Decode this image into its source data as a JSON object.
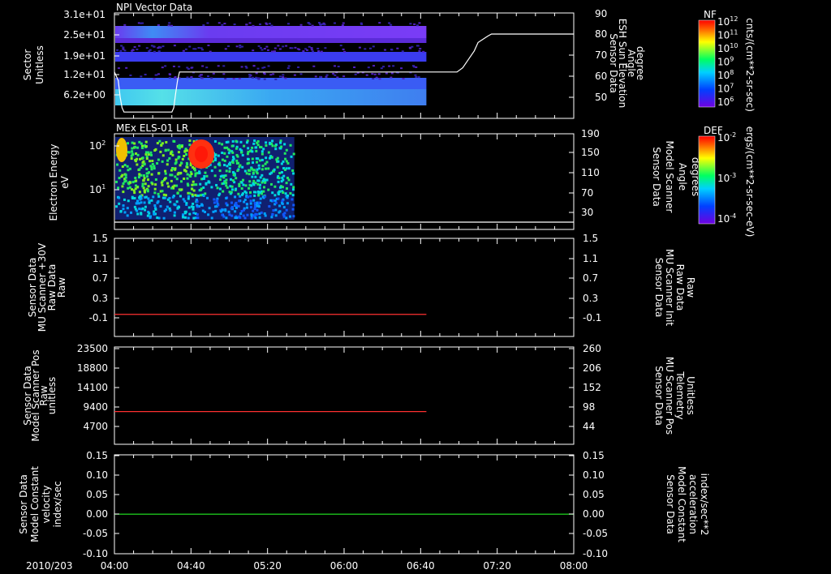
{
  "chart_data": [
    {
      "type": "heatmap",
      "title": "NPI Vector Data",
      "ylabel": [
        "Sector",
        "Unitless"
      ],
      "yticks": [
        "3.1e+01",
        "2.5e+01",
        "1.9e+01",
        "1.2e+01",
        "6.2e+00"
      ],
      "y2label": [
        "Sensor Data",
        "ESH Sun Elevation",
        "Angle",
        "degree"
      ],
      "y2ticks": [
        90,
        80,
        70,
        60,
        50
      ],
      "y2lim": [
        40,
        90
      ],
      "overlay_line": {
        "name": "ESH Sun Elevation Angle",
        "x": [
          "04:00",
          "04:02",
          "04:03",
          "04:04",
          "04:05",
          "04:06",
          "04:30",
          "04:31",
          "04:32",
          "04:33",
          "04:34",
          "06:59",
          "07:02",
          "07:05",
          "07:08",
          "07:10",
          "07:15",
          "07:17",
          "08:00"
        ],
        "y": [
          62,
          58,
          50,
          45,
          43,
          43,
          43,
          45,
          52,
          58,
          62,
          62,
          64,
          68,
          72,
          76,
          79,
          80,
          80
        ]
      },
      "colorbar": {
        "label": "NF",
        "units": "cnts/(cm**2-sr-sec)",
        "ticks": [
          "10^12",
          "10^11",
          "10^10",
          "10^9",
          "10^8",
          "10^7",
          "10^6"
        ]
      }
    },
    {
      "type": "heatmap",
      "title": "MEx ELS-01 LR",
      "ylabel": [
        "Electron Energy",
        "eV"
      ],
      "yticks": [
        "10^2",
        "10^1"
      ],
      "y2label": [
        "Sensor Data",
        "Model Scanner",
        "Angle",
        "degrees"
      ],
      "y2ticks": [
        190,
        150,
        110,
        70,
        30
      ],
      "colorbar": {
        "label": "DEF",
        "units": "ergs/(cm**2-sr-sec-eV)",
        "ticks": [
          "10^-2",
          "10^-3",
          "10^-4"
        ]
      }
    },
    {
      "type": "line",
      "ylabel": [
        "Sensor Data",
        "MU Scanner +30V",
        "Raw Data",
        "Raw"
      ],
      "yticks": [
        "1.5",
        "1.1",
        "0.7",
        "0.3",
        "-0.1"
      ],
      "ylim": [
        -0.5,
        1.5
      ],
      "y2label": [
        "Sensor Data",
        "MU Scanner Init",
        "Raw Data",
        "Raw"
      ],
      "y2ticks": [
        "1.5",
        "1.1",
        "0.7",
        "0.3",
        "-0.1"
      ],
      "series": [
        {
          "color": "#ff3030",
          "x": [
            "04:00",
            "06:43"
          ],
          "y": [
            -0.05,
            -0.05
          ]
        }
      ]
    },
    {
      "type": "line",
      "ylabel": [
        "Sensor Data",
        "Model Scanner Pos",
        "Raw",
        "unitless"
      ],
      "yticks": [
        "23500",
        "18800",
        "14100",
        "9400",
        "4700"
      ],
      "ylim": [
        0,
        23500
      ],
      "y2label": [
        "Sensor Data",
        "MU Scanner Pos",
        "Telemetry",
        "Unitless"
      ],
      "y2ticks": [
        "260",
        "206",
        "152",
        "98",
        "44"
      ],
      "series": [
        {
          "color": "#ff3030",
          "x": [
            "04:00",
            "06:43"
          ],
          "y": [
            7900,
            7900
          ]
        }
      ]
    },
    {
      "type": "line",
      "ylabel": [
        "Sensor Data",
        "Model Constant",
        "velocity",
        "index/sec"
      ],
      "yticks": [
        "0.15",
        "0.10",
        "0.05",
        "0.00",
        "-0.05",
        "-0.10"
      ],
      "ylim": [
        -0.1,
        0.15
      ],
      "y2label": [
        "Sensor Data",
        "Model Constant",
        "acceleration",
        "index/sec**2"
      ],
      "y2ticks": [
        "0.15",
        "0.10",
        "0.05",
        "0.00",
        "-0.05",
        "-0.10"
      ],
      "series": [
        {
          "color": "#22ee22",
          "x": [
            "04:00",
            "08:00"
          ],
          "y": [
            0.0,
            0.0
          ]
        }
      ]
    }
  ],
  "xaxis": {
    "date_label": "2010/203",
    "ticks": [
      "04:00",
      "04:40",
      "05:20",
      "06:00",
      "06:40",
      "07:20",
      "08:00"
    ],
    "range": [
      "04:00",
      "08:00"
    ]
  },
  "colors": {
    "background": "#000000",
    "axis": "#ffffff",
    "red_label": "#ff2020",
    "green_label": "#22ee22"
  }
}
